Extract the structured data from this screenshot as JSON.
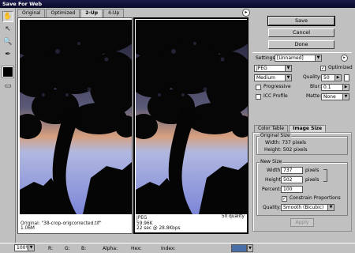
{
  "window": {
    "title": "Save For Web"
  },
  "tabs": [
    {
      "label": "Original"
    },
    {
      "label": "Optimized"
    },
    {
      "label": "2-Up"
    },
    {
      "label": "4-Up"
    }
  ],
  "panes": {
    "original": {
      "line1": "Original: \"38-crop-origcorrected.tif\"",
      "line2": "1.06M"
    },
    "optimized": {
      "line1": "JPEG",
      "line2": "59.96K",
      "line3": "22 sec @ 28.8Kbps",
      "quality": "50 quality"
    }
  },
  "buttons": {
    "save": "Save",
    "cancel": "Cancel",
    "done": "Done",
    "apply": "Apply"
  },
  "settings": {
    "label": "Settings:",
    "preset": "[Unnamed]",
    "format": "JPEG",
    "optimized_label": "Optimized",
    "optimized_checked": true,
    "compression": "Medium",
    "quality_label": "Quality:",
    "quality": "50",
    "progressive_label": "Progressive",
    "blur_label": "Blur:",
    "blur": "0.1",
    "icc_label": "ICC Profile",
    "matte_label": "Matte:",
    "matte": "None"
  },
  "panel_tabs": [
    {
      "label": "Color Table"
    },
    {
      "label": "Image Size"
    }
  ],
  "original_size": {
    "title": "Original Size",
    "width": "Width: 737 pixels",
    "height": "Height: 502 pixels"
  },
  "new_size": {
    "title": "New Size",
    "width_label": "Width:",
    "width": "737",
    "height_label": "Height:",
    "height": "502",
    "unit": "pixels",
    "percent_label": "Percent:",
    "percent": "100",
    "constrain_label": "Constrain Proportions",
    "constrain_checked": true,
    "quality_label": "Quality:",
    "quality": "Smooth (Bicubic)"
  },
  "status": {
    "zoom": "100%",
    "r": "R:",
    "g": "G:",
    "b": "B:",
    "alpha": "Alpha:",
    "hex": "Hex:",
    "index": "Index:"
  }
}
